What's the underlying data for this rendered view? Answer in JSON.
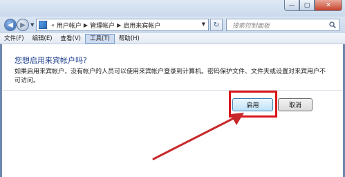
{
  "window": {
    "controls": {
      "minimize": "—",
      "maximize": "▢",
      "close": "✕"
    }
  },
  "nav": {
    "breadcrumb_prefix": "«",
    "breadcrumbs": [
      "用户帐户",
      "管理帐户",
      "启用来宾帐户"
    ],
    "search_placeholder": "搜索控制面板"
  },
  "menu": {
    "items": [
      "文件(F)",
      "编辑(E)",
      "查看(V)",
      "工具(T)",
      "帮助(H)"
    ],
    "active": "工具(T)"
  },
  "dialog": {
    "heading": "您想启用来宾帐户吗?",
    "description": "如果启用来宾帐户，没有帐户的人员可以使用来宾帐户登录到计算机。密码保护文件、文件夹或设置对来宾用户不可访问。",
    "enable_label": "启用",
    "cancel_label": "取消"
  },
  "annotation": {
    "highlight_color": "#d9151b",
    "arrow_color": "#c8282a"
  }
}
